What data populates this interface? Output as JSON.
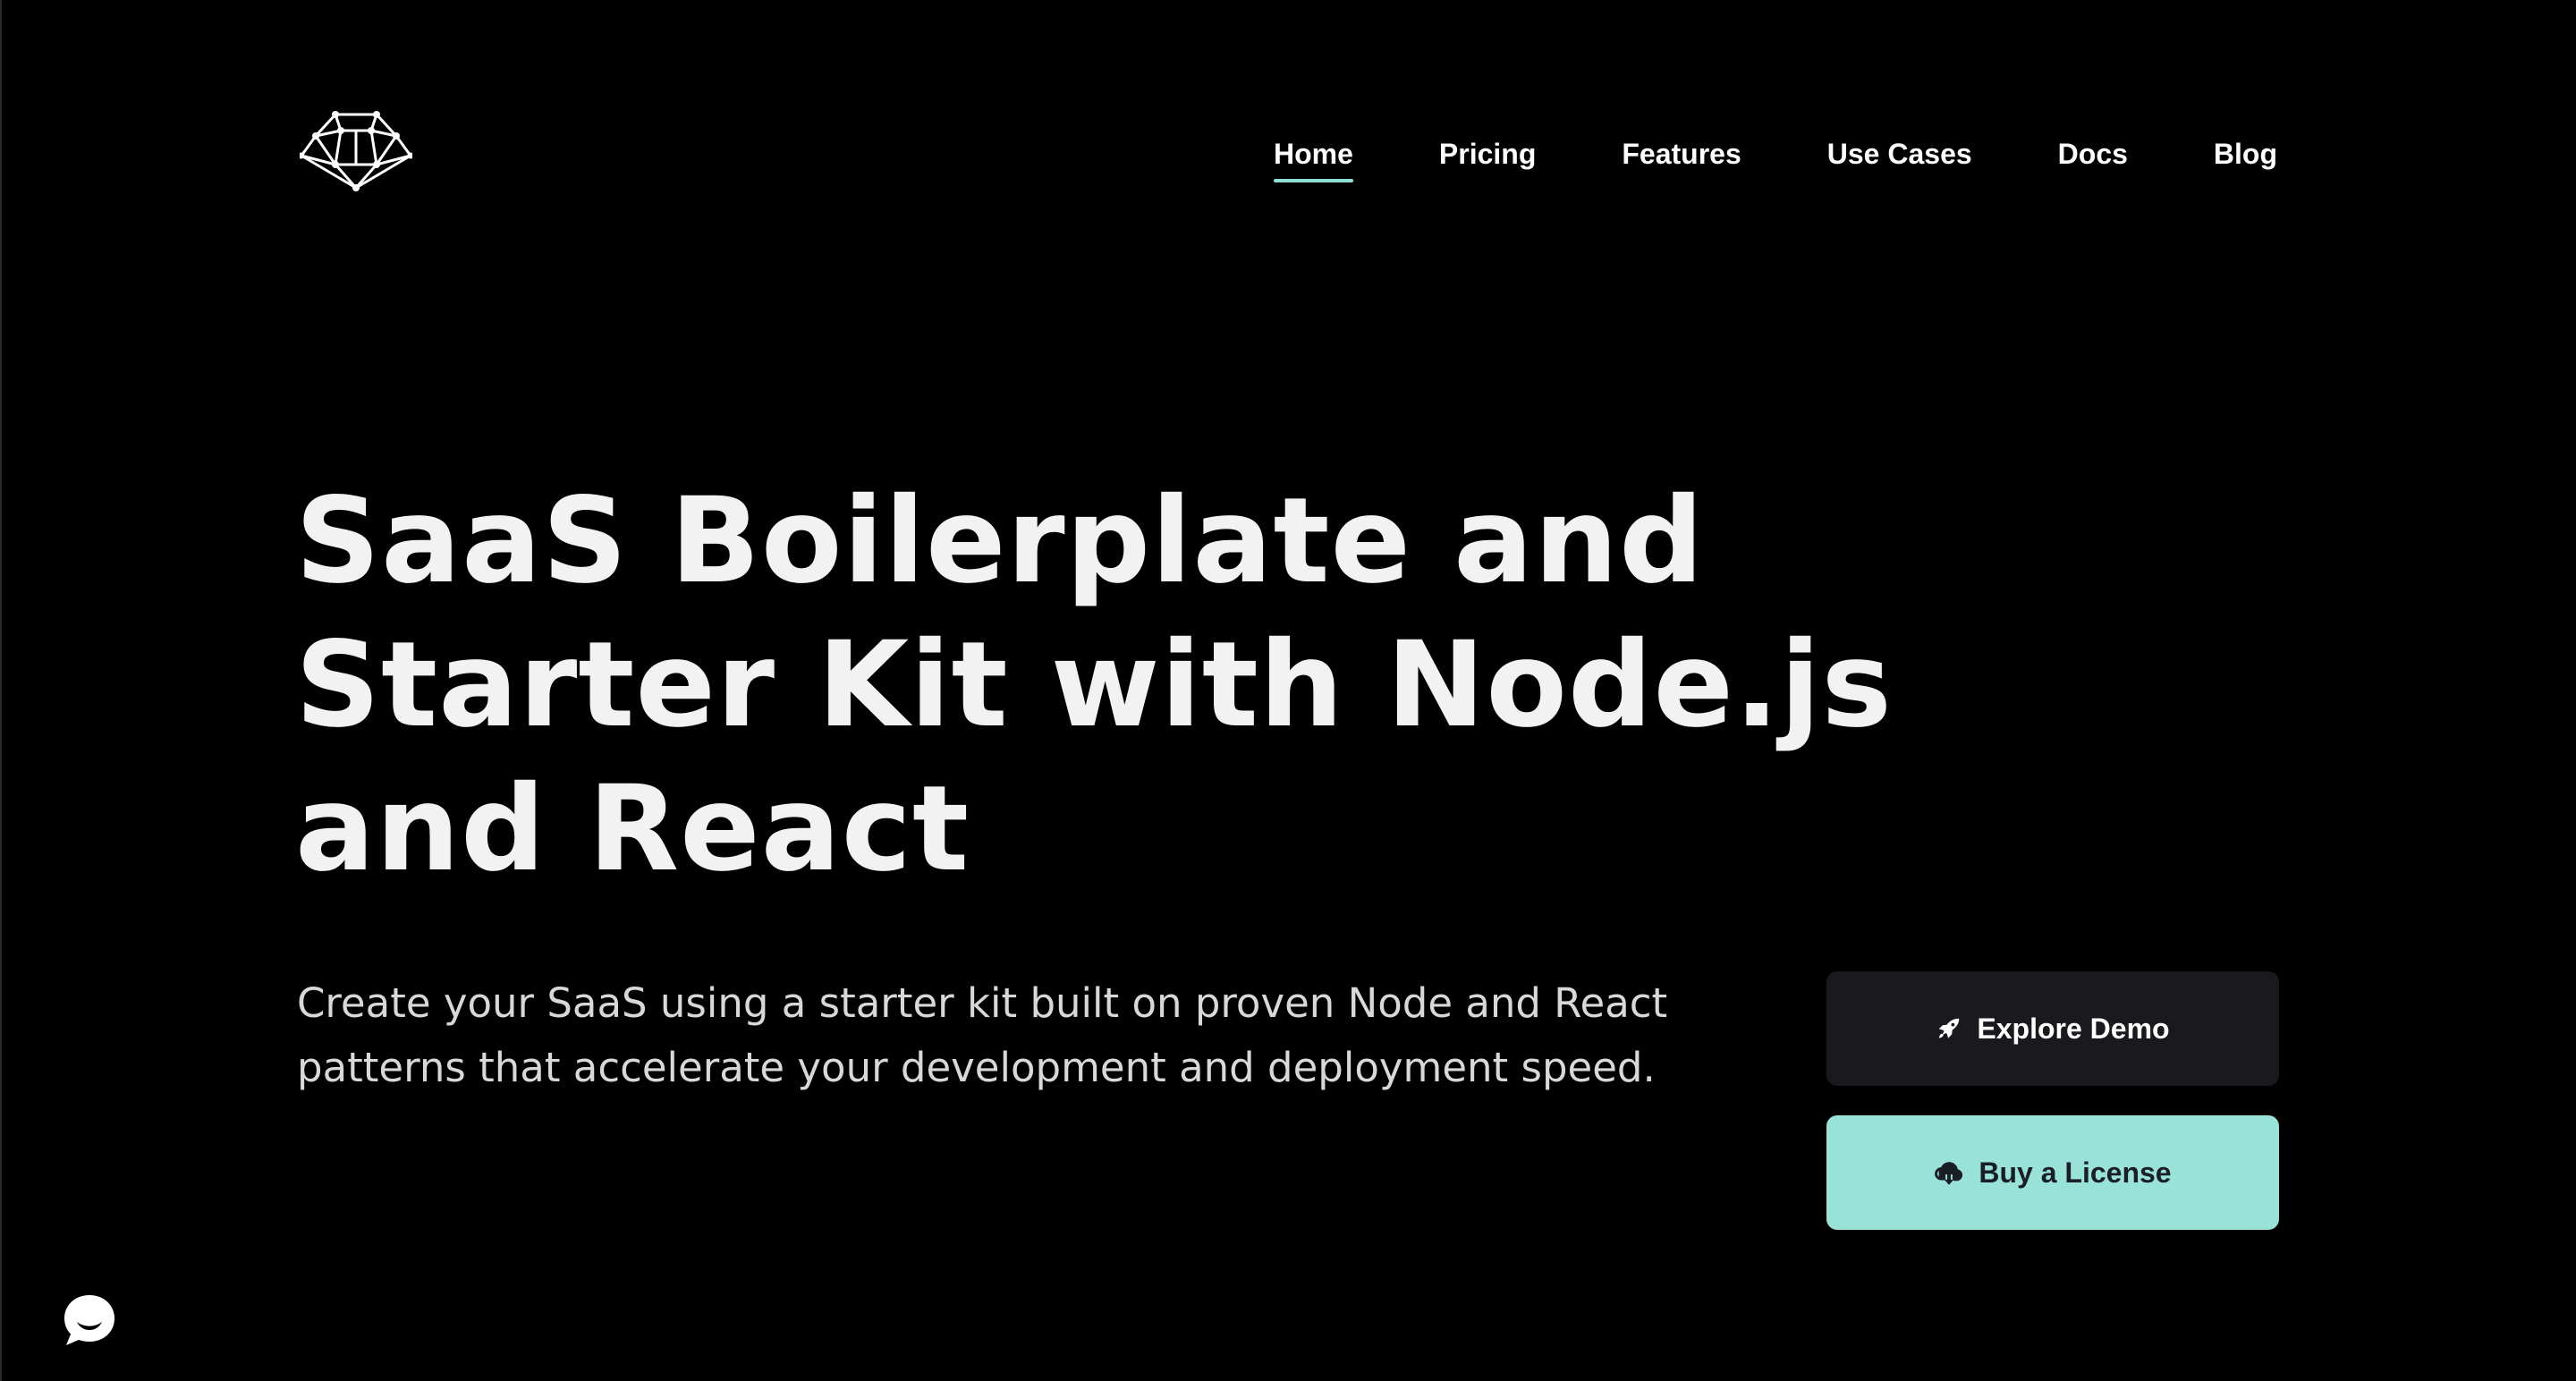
{
  "header": {
    "logo_icon": "geodesic-dome-logo-icon",
    "nav": [
      {
        "label": "Home",
        "active": true
      },
      {
        "label": "Pricing",
        "active": false
      },
      {
        "label": "Features",
        "active": false
      },
      {
        "label": "Use Cases",
        "active": false
      },
      {
        "label": "Docs",
        "active": false
      },
      {
        "label": "Blog",
        "active": false
      }
    ]
  },
  "hero": {
    "title_lines": [
      "SaaS Boilerplate and",
      "Starter Kit with Node.js",
      "and React"
    ],
    "subtitle_lines": [
      "Create your SaaS using a starter kit built on proven Node and React",
      "patterns that accelerate your development and deployment speed."
    ]
  },
  "actions": {
    "explore_demo": {
      "label": "Explore Demo",
      "icon": "rocket-icon"
    },
    "buy_license": {
      "label": "Buy a License",
      "icon": "cloud-download-icon"
    }
  },
  "chat": {
    "icon": "chat-bubble-icon"
  },
  "colors": {
    "background": "#000000",
    "accent": "#98e2d8",
    "nav_underline": "#8fe0d4",
    "secondary_button": "#1a1a1e",
    "text": "#ffffff"
  }
}
